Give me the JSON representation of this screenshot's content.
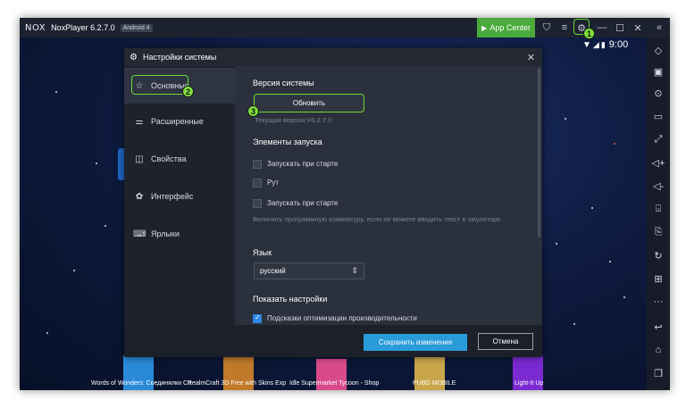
{
  "titlebar": {
    "logo": "NOX",
    "version_label": "NoxPlayer 6.2.7.0",
    "android_badge": "Android 4",
    "app_center_label": "App Center"
  },
  "statusbar": {
    "time": "9:00"
  },
  "annotations": {
    "badge1": "1",
    "badge2": "2",
    "badge3": "3"
  },
  "dialog": {
    "title": "Настройки системы",
    "nav": [
      {
        "label": "Основные",
        "icon": "star-icon"
      },
      {
        "label": "Расширенные",
        "icon": "sliders-icon"
      },
      {
        "label": "Свойства",
        "icon": "book-icon"
      },
      {
        "label": "Интерфейс",
        "icon": "palette-icon"
      },
      {
        "label": "Ярлыки",
        "icon": "keyboard-icon"
      }
    ],
    "content": {
      "system_version_title": "Версия системы",
      "update_label": "Обновить",
      "current_version": "Текущая версия:V6.2.7.0",
      "launch_items_title": "Элементы запуска",
      "checkboxes": [
        {
          "label": "Запускать при старте",
          "checked": false
        },
        {
          "label": "Рут",
          "checked": false
        },
        {
          "label": "Запускать при старте",
          "checked": false
        }
      ],
      "keyboard_hint": "Включить программную клавиатуру, если не можете вводить текст в эмуляторе",
      "language_title": "Язык",
      "language_value": "русский",
      "show_settings_title": "Показать настройки",
      "optimization_hint": {
        "label": "Подсказки оптимизации производительности",
        "checked": true
      }
    },
    "save_label": "Сохранить изменения",
    "cancel_label": "Отмена"
  },
  "apps": [
    "Words of Wonders: Соединялки Сл",
    "RealmCraft 3D Free with Skins Exp",
    "Idle Supermarket Tycoon - Shop",
    "PUBG MOBILE",
    "Light-It Up"
  ],
  "colors": {
    "highlight_green": "#6cdc34",
    "app_center": "#4aaa3c",
    "save_button": "#2a9bd9",
    "dialog_bg": "#232833"
  }
}
